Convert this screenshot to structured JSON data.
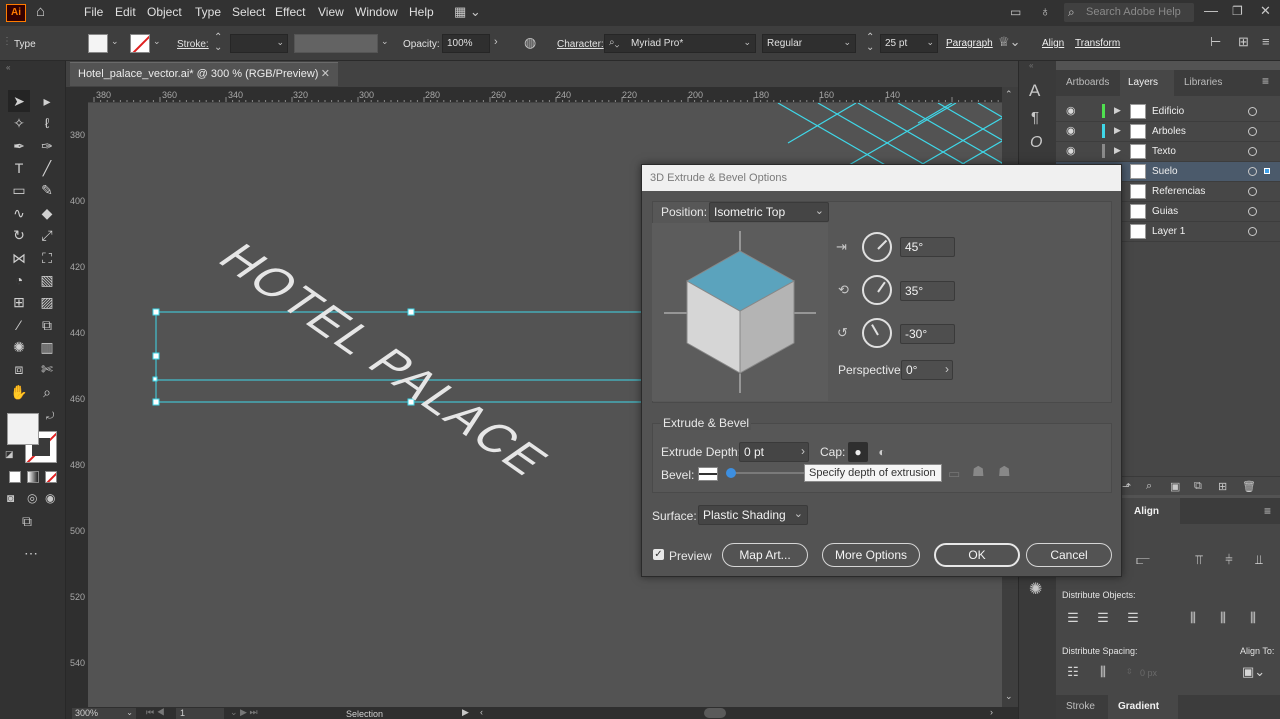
{
  "app": {
    "logo": "Ai"
  },
  "menu": [
    "File",
    "Edit",
    "Object",
    "Type",
    "Select",
    "Effect",
    "View",
    "Window",
    "Help"
  ],
  "search": {
    "placeholder": "Search Adobe Help"
  },
  "control_bar": {
    "type_label": "Type",
    "stroke_label": "Stroke:",
    "opacity_label": "Opacity:",
    "opacity_value": "100%",
    "character_label": "Character:",
    "font_family": "Myriad Pro*",
    "font_style": "Regular",
    "font_size": "25 pt",
    "paragraph_label": "Paragraph",
    "align_label": "Align",
    "transform_label": "Transform"
  },
  "document": {
    "tab_title": "Hotel_palace_vector.ai* @ 300 % (RGB/Preview)",
    "artwork_text": "HOTEL PALACE",
    "ruler_top": [
      "380",
      "360",
      "340",
      "320",
      "300",
      "280",
      "260",
      "240",
      "220",
      "200",
      "180",
      "160",
      "140"
    ],
    "ruler_left": [
      "380",
      "400",
      "420",
      "440",
      "460",
      "480",
      "500",
      "520",
      "540"
    ]
  },
  "status_bar": {
    "zoom": "300%",
    "page": "1",
    "tool": "Selection"
  },
  "panels": {
    "tabs": [
      "Artboards",
      "Layers",
      "Libraries"
    ],
    "active_tab": "Layers",
    "layers": [
      {
        "name": "Edificio",
        "color": "#4fe04f",
        "visible": true,
        "selected": false
      },
      {
        "name": "Arboles",
        "color": "#3fd7e8",
        "visible": true,
        "selected": false
      },
      {
        "name": "Texto",
        "color": "#8a8a8a",
        "visible": true,
        "selected": false
      },
      {
        "name": "Suelo",
        "color": "#3fa0e8",
        "visible": false,
        "selected": true
      },
      {
        "name": "Referencias",
        "color": "#e84f4f",
        "visible": false,
        "selected": false
      },
      {
        "name": "Guias",
        "color": "#e8c03f",
        "visible": false,
        "selected": false
      },
      {
        "name": "Layer 1",
        "color": "#c84fe8",
        "visible": false,
        "selected": false
      }
    ],
    "align": {
      "title": "Align",
      "distribute_objects": "Distribute Objects:",
      "distribute_spacing": "Distribute Spacing:",
      "align_to": "Align To:",
      "spacing_value": "0 px"
    },
    "bottom_tabs": [
      "Stroke",
      "Gradient"
    ]
  },
  "dialog": {
    "title": "3D Extrude & Bevel Options",
    "position_label": "Position:",
    "position_value": "Isometric Top",
    "rot_x": "45°",
    "rot_y": "35°",
    "rot_z": "-30°",
    "perspective_label": "Perspective:",
    "perspective_value": "0°",
    "extrude_section": "Extrude & Bevel",
    "extrude_depth_label": "Extrude Depth:",
    "extrude_depth_value": "0 pt",
    "cap_label": "Cap:",
    "bevel_label": "Bevel:",
    "surface_label": "Surface:",
    "surface_value": "Plastic Shading",
    "preview_label": "Preview",
    "preview_checked": true,
    "buttons": {
      "map_art": "Map Art...",
      "more_options": "More Options",
      "ok": "OK",
      "cancel": "Cancel"
    },
    "tooltip": "Specify depth of extrusion",
    "cube_colors": {
      "top": "#5ba3bd",
      "left": "#d6d6d6",
      "right": "#b4b4b4"
    }
  }
}
